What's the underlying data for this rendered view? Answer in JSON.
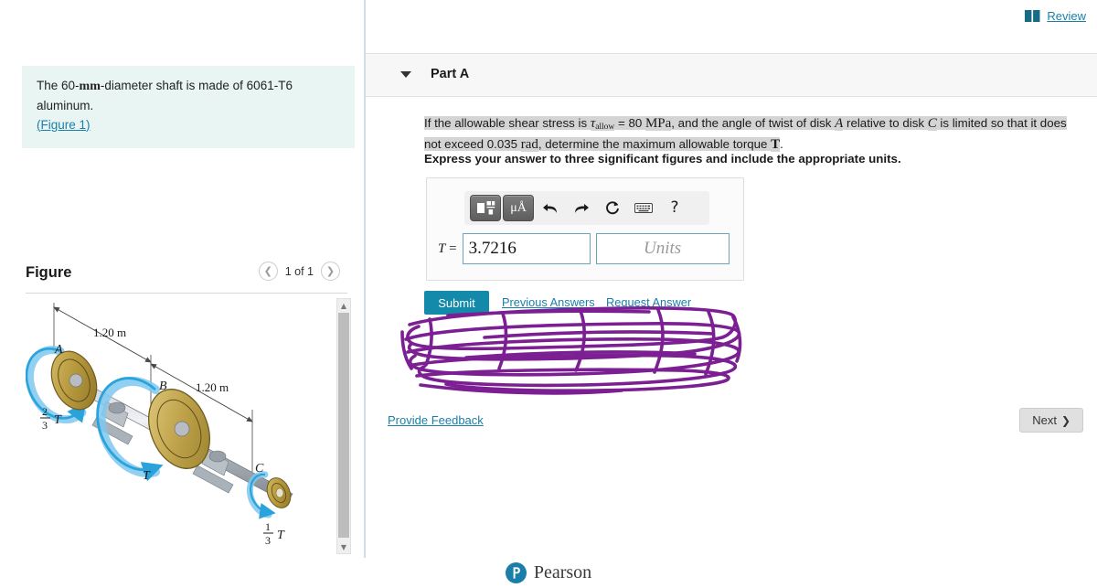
{
  "header": {
    "review_label": "Review",
    "review_icon": "book-icon"
  },
  "left": {
    "problem_prefix": "The 60-",
    "problem_unit": "mm",
    "problem_suffix": "-diameter shaft is made of 6061-T6 aluminum.",
    "figure_link": "(Figure 1)",
    "figure_title": "Figure",
    "figure_count": "1 of 1",
    "prev_icon": "chevron-left-icon",
    "next_icon": "chevron-right-icon"
  },
  "figure": {
    "label_a": "A",
    "label_b": "B",
    "label_c": "C",
    "dim_left": "1.20 m",
    "dim_right": "1.20 m",
    "torque_a_num": "2",
    "torque_a_den": "3",
    "torque_a_sym": "T",
    "torque_b_sym": "T",
    "torque_c_num": "1",
    "torque_c_den": "3",
    "torque_c_sym": "T"
  },
  "part": {
    "caret_icon": "chevron-down-icon",
    "title": "Part A",
    "question": {
      "t1": "If the allowable shear stress is ",
      "tau": "τ",
      "tau_sub": "allow",
      "t2": " = 80 ",
      "mpa": "MPa",
      "t3": ", and the angle of twist of disk ",
      "diskA": "A",
      "t4": " relative to disk ",
      "diskC": "C",
      "t5": " is limited so that it does not exceed 0.035 ",
      "rad": "rad",
      "t6": ", determine the maximum allowable torque ",
      "torqueT": "T",
      "t7": "."
    },
    "instruction": "Express your answer to three significant figures and include the appropriate units."
  },
  "answer": {
    "toolbar": [
      {
        "name": "template-icon",
        "glyph": "",
        "style": "dark"
      },
      {
        "name": "units-mu-angstrom-icon",
        "glyph": "μÅ",
        "style": "dark"
      },
      {
        "name": "undo-icon",
        "glyph": "↰",
        "style": "plain"
      },
      {
        "name": "redo-icon",
        "glyph": "↱",
        "style": "plain"
      },
      {
        "name": "reset-icon",
        "glyph": "↻",
        "style": "plain"
      },
      {
        "name": "keyboard-icon",
        "glyph": "⌨",
        "style": "plain"
      },
      {
        "name": "help-icon",
        "glyph": "?",
        "style": "plain"
      }
    ],
    "eq_var": "T",
    "eq_sign": " =",
    "value": "3.7216",
    "units_placeholder": "Units"
  },
  "actions": {
    "submit_label": "Submit",
    "previous_answers_label": "Previous Answers",
    "request_answer_label": "Request Answer",
    "feedback_label": "Provide Feedback",
    "next_label": "Next",
    "next_icon": "chevron-right-icon"
  },
  "annotation": {
    "name": "purple-scribble-overlay",
    "color": "#7b1f92"
  },
  "footer": {
    "brand": "Pearson",
    "logo_letter": "P"
  },
  "colors": {
    "accent_teal": "#148aab",
    "link_blue": "#1a7fa8",
    "problem_bg": "#e8f5f3",
    "panel_gray": "#f7f7f7",
    "scribble_purple": "#7b1f92"
  }
}
